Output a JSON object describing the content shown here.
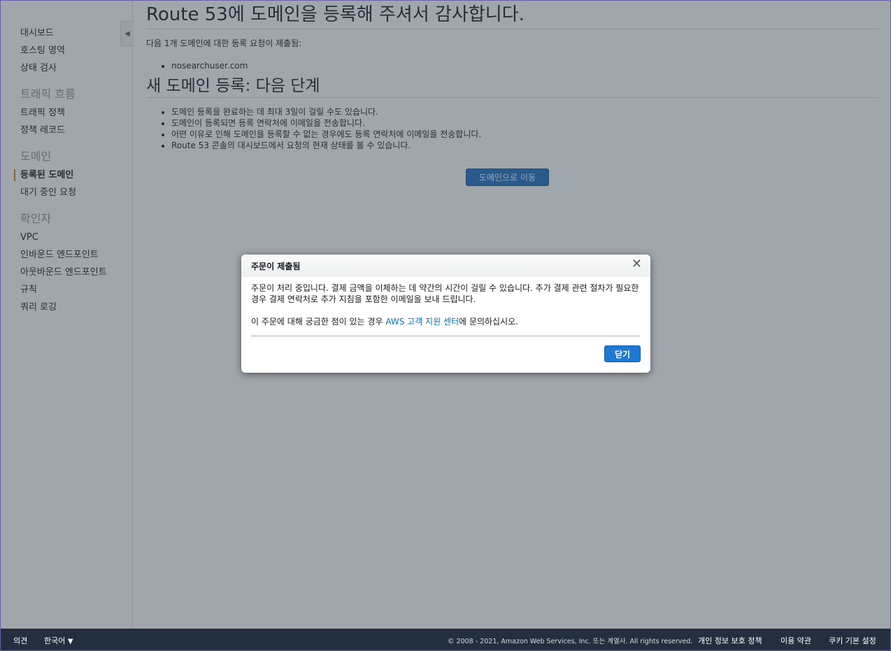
{
  "sidebar": {
    "collapse_icon": "◀",
    "group1": [
      "대시보드",
      "호스팅 영역",
      "상태 검사"
    ],
    "section_traffic": "트래픽 흐름",
    "group2": [
      "트래픽 정책",
      "정책 레코드"
    ],
    "section_domains": "도메인",
    "domain_active": "등록된 도메인",
    "domain_pending": "대기 중인 요청",
    "section_resolver": "확인자",
    "group4": [
      "VPC",
      "인바운드 엔드포인트",
      "아웃바운드 엔드포인트",
      "규칙",
      "쿼리 로깅"
    ]
  },
  "main": {
    "title": "Route 53에 도메인을 등록해 주셔서 감사합니다.",
    "intro": "다음 1개 도메인에 대한 등록 요청이 제출됨:",
    "domains": [
      "nosearchuser.com"
    ],
    "next_title": "새 도메인 등록: 다음 단계",
    "steps": [
      "도메인 등록을 완료하는 데 최대 3일이 걸릴 수도 있습니다.",
      "도메인이 등록되면 등록 연락처에 이메일을 전송합니다.",
      "어떤 이유로 인해 도메인을 등록할 수 없는 경우에도 등록 연락처에 이메일을 전송합니다.",
      "Route 53 콘솔의 대시보드에서 요청의 현재 상태를 볼 수 있습니다."
    ],
    "goto_button": "도메인으로 이동"
  },
  "modal": {
    "title": "주문이 제출됨",
    "close_icon": "✕",
    "body_line1": "주문이 처리 중입니다. 결제 금액을 이체하는 데 약간의 시간이 걸릴 수 있습니다. 추가 결제 관련 절차가 필요한 경우 결제 연락처로 추가 지침을 포함한 이메일을 보내 드립니다.",
    "body_line2_prefix": "이 주문에 대해 궁금한 점이 있는 경우 ",
    "support_link": "AWS 고객 지원 센터",
    "body_line2_suffix": "에 문의하십시오.",
    "close_button": "닫기"
  },
  "footer": {
    "feedback": "의견",
    "language": "한국어",
    "language_caret": "▼",
    "copyright": "© 2008 - 2021, Amazon Web Services, Inc. 또는 계열사. All rights reserved.",
    "privacy": "개인 정보 보호 정책",
    "terms": "이용 약관",
    "cookies": "쿠키 기본 설정"
  },
  "colors": {
    "accent_active": "#ec7211",
    "primary_button": "#1f78d1",
    "footer_bg": "#232f3e",
    "link": "#0073bb"
  }
}
